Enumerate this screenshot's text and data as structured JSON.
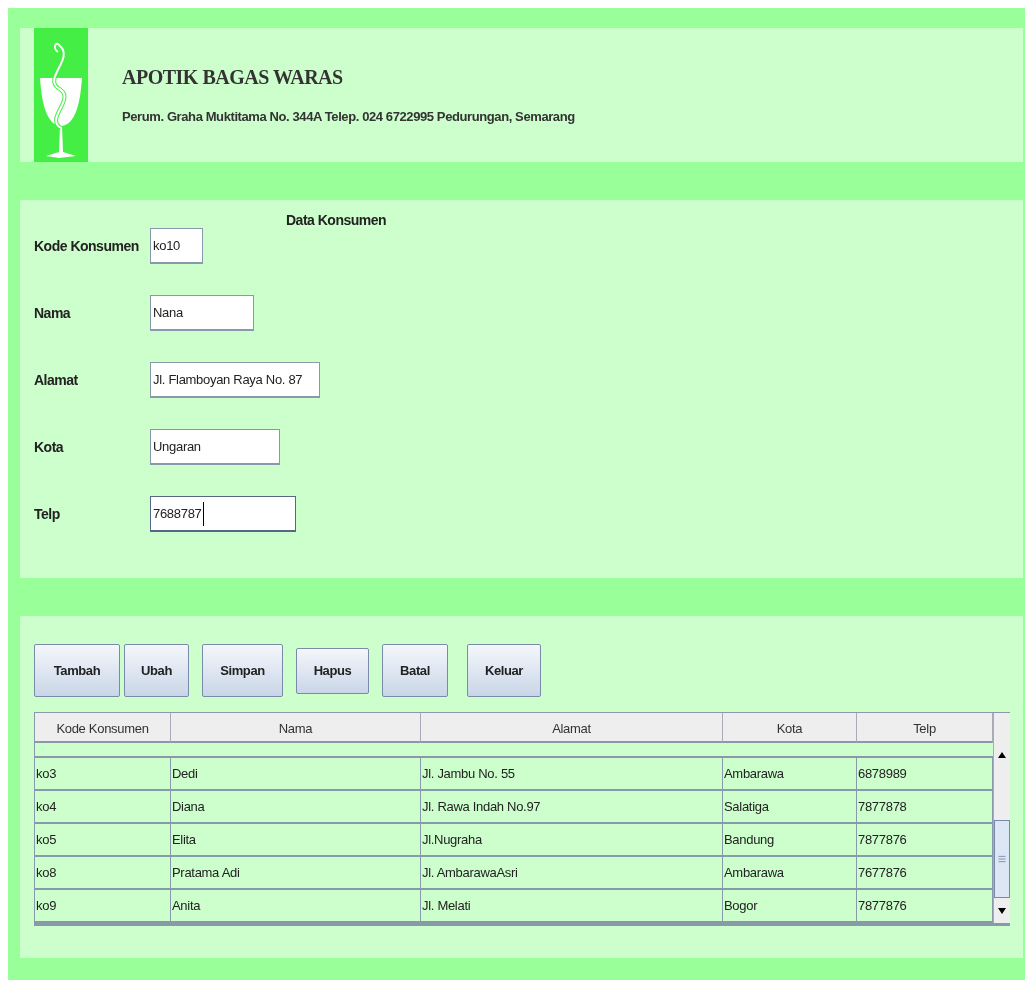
{
  "header": {
    "title": "APOTIK BAGAS WARAS",
    "address": "Perum. Graha Muktitama No. 344A Telep. 024 6722995 Pedurungan, Semarang"
  },
  "form": {
    "title": "Data Konsumen",
    "fields": [
      {
        "label": "Kode Konsumen",
        "value": "ko10",
        "focused": false
      },
      {
        "label": "Nama",
        "value": "Nana",
        "focused": false
      },
      {
        "label": "Alamat",
        "value": "Jl. Flamboyan Raya No. 87",
        "focused": false
      },
      {
        "label": "Kota",
        "value": "Ungaran",
        "focused": false
      },
      {
        "label": "Telp",
        "value": "7688787",
        "focused": true
      }
    ]
  },
  "buttons": [
    "Tambah",
    "Ubah",
    "Simpan",
    "Hapus",
    "Batal",
    "Keluar"
  ],
  "table": {
    "columns": [
      "Kode Konsumen",
      "Nama",
      "Alamat",
      "Kota",
      "Telp"
    ],
    "rows": [
      [
        "ko3",
        "Dedi",
        "Jl. Jambu No. 55",
        "Ambarawa",
        "6878989"
      ],
      [
        "ko4",
        "Diana",
        "Jl. Rawa Indah No.97",
        "Salatiga",
        "7877878"
      ],
      [
        "ko5",
        "Elita",
        "Jl.Nugraha",
        "Bandung",
        "7877876"
      ],
      [
        "ko8",
        "Pratama Adi",
        "Jl. AmbarawaAsri",
        "Ambarawa",
        "7677876"
      ],
      [
        "ko9",
        "Anita",
        "Jl. Melati",
        "Bogor",
        "7877876"
      ]
    ]
  }
}
